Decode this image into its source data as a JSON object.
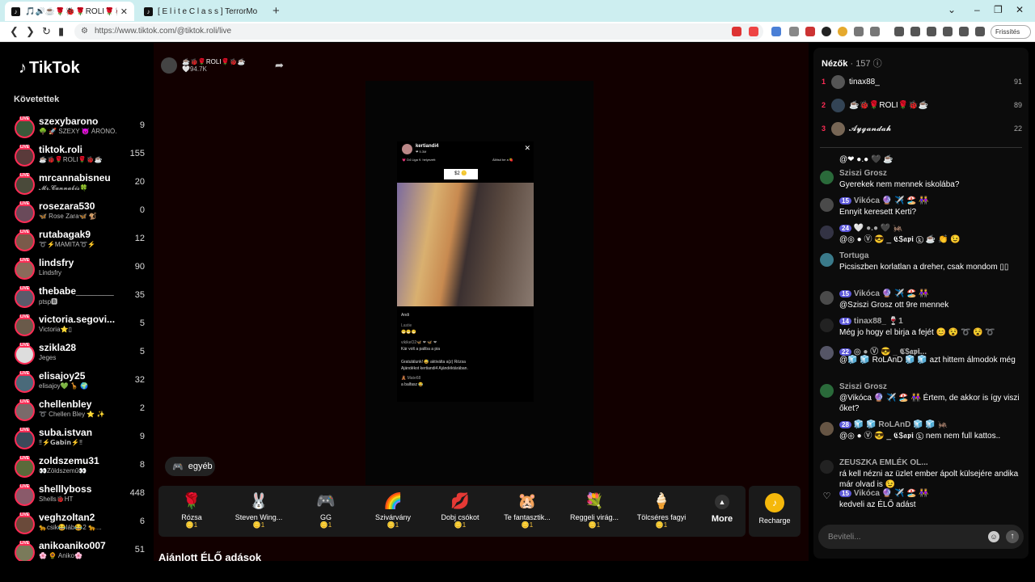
{
  "browser": {
    "tabs": [
      {
        "label": "🎵🔊☕🌹🐞🌹ROLI🌹🐞☕ (@tik",
        "active": true
      },
      {
        "label": "[ E l i t e  C l a s s ] TerrorMo",
        "active": false
      }
    ],
    "url": "https://www.tiktok.com/@tiktok.roli/live",
    "refresh_label": "Frissítés"
  },
  "logo": "TikTok",
  "sidebar": {
    "following_title": "Követettek",
    "items": [
      {
        "name": "szexybarono",
        "sub": "🌳 🚀 SZEXY 👿 ÁRÓNÓ...",
        "count": "9"
      },
      {
        "name": "tiktok.roli",
        "sub": "☕🐞🌹ROLI🌹🐞☕",
        "count": "155"
      },
      {
        "name": "mrcannabisneu",
        "sub": "𝓜𝓻.𝓒𝓪𝓷𝓷𝓪𝓫𝓲𝓼🍀",
        "count": "20"
      },
      {
        "name": "rosezara530",
        "sub": "🦋 Rose Zara🦋 🐒",
        "count": "0"
      },
      {
        "name": "rutabagak9",
        "sub": "➰⚡MAMITA➰⚡",
        "count": "12"
      },
      {
        "name": "lindsfry",
        "sub": "Lindsfry",
        "count": "90"
      },
      {
        "name": "thebabe_______",
        "sub": "ptsp🅱",
        "count": "35"
      },
      {
        "name": "victoria.segovi...",
        "sub": "Victoria⭐▯",
        "count": "5"
      },
      {
        "name": "szikla28",
        "sub": "Jeges",
        "count": "5"
      },
      {
        "name": "elisajoy25",
        "sub": "elisajoy💚 🦒 🌍",
        "count": "32"
      },
      {
        "name": "chellenbley",
        "sub": "➰ Chellen Bley ⭐ ✨",
        "count": "2"
      },
      {
        "name": "suba.istvan",
        "sub": "‼⚡𝗚𝗮𝗯𝗶𝗻⚡‼",
        "count": "9"
      },
      {
        "name": "zoldszemu31",
        "sub": "👀Zöldszemű👀",
        "count": "8"
      },
      {
        "name": "shelllyboss",
        "sub": "Shells🐞HT",
        "count": "448"
      },
      {
        "name": "veghzoltan2",
        "sub": "🐆csik😂láb😂2 🐆...",
        "count": "6"
      },
      {
        "name": "anikoaniko007",
        "sub": "🌸 🌻 Aniko🌸",
        "count": "51"
      }
    ]
  },
  "stream": {
    "streamer_name": "☕🐞🌹ROLI🌹🐞☕",
    "likes": "🤍94.7K",
    "inner": {
      "host": "kertiandi4",
      "host_likes": "❤ 5.3M",
      "league": "💗 D4 Liga 9. helyezett",
      "goal": "Állítsd be a 🍓",
      "score": "$2 🪙",
      "chat": [
        "Andi",
        "Lastie",
        "😁😁😁",
        "vikikeO2🦋 ❤ 🦋 ❤",
        "Kár volt a paliba a pia",
        "Gratulálunk! 😅 aktiválta a(z) Rózsa",
        "Ajándékot kertiandi4 Ajándéktárában.",
        "🧸 Mate68",
        "a balfasz 😂"
      ]
    },
    "gift_button": "egyéb",
    "gifts": [
      {
        "icon": "🌹",
        "name": "Rózsa",
        "price": "🪙1"
      },
      {
        "icon": "🐰",
        "name": "Steven Wing...",
        "price": "🪙1"
      },
      {
        "icon": "🎮",
        "name": "GG",
        "price": "🪙1"
      },
      {
        "icon": "🌈",
        "name": "Szivárvány",
        "price": "🪙1"
      },
      {
        "icon": "💋",
        "name": "Dobj csókot",
        "price": "🪙1"
      },
      {
        "icon": "🐹",
        "name": "Te fantasztik...",
        "price": "🪙1"
      },
      {
        "icon": "💐",
        "name": "Reggeli virág...",
        "price": "🪙1"
      },
      {
        "icon": "🍦",
        "name": "Tölcséres fagyi",
        "price": "🪙1"
      }
    ],
    "more_label": "More",
    "recharge_label": "Recharge",
    "recommended": "Ajánlott ÉLŐ adások"
  },
  "chat": {
    "viewers_label": "Nézők",
    "viewer_count": "· 157",
    "top": [
      {
        "rank": "1",
        "name": "tinax88_",
        "score": "91"
      },
      {
        "rank": "2",
        "name": "☕🐞🌹ROLI🌹🐞☕",
        "score": "89"
      },
      {
        "rank": "3",
        "name": "𝓐𝔂𝓰𝓪𝓷𝓭𝓪𝓱",
        "score": "22"
      }
    ],
    "messages": [
      {
        "badge": "",
        "author": "",
        "text": "@❤ ●.● 🖤 ☕"
      },
      {
        "badge": "",
        "author": "Szi­szi Grosz",
        "text": "Gyerekek nem mennek iskolába?"
      },
      {
        "badge": "15",
        "author": "Vikóca 🔮 ✈️ 🏖️ 👭",
        "text": "Ennyit keresett Kerti?"
      },
      {
        "badge": "24",
        "author": "🤍 ●.● 🖤 🦗",
        "text": "@◎ ● Ⓥ 😎 _ 𝕮$𝖆𝖕𝖎 ⓚ ☕ 👏 😉"
      },
      {
        "badge": "",
        "author": "Tortuga",
        "text": "Picsiszben korlatlan a dreher, csak mondom ▯▯"
      },
      {
        "badge": "15",
        "author": "Vikóca 🔮 ✈️ 🏖️ 👭",
        "text": "@Sziszi Grosz ott 9re mennek"
      },
      {
        "badge": "14",
        "author": "tinax88_ 🍷1",
        "text": "Még jo hogy el birja a fejét 😊 😵 ➰ 😵 ➰"
      },
      {
        "badge": "22",
        "author": "◎ ● Ⓥ 😎 _ 𝕮$𝖆𝖕𝖎...",
        "text": "@🧊 🧊 RoLAnD 🧊 🧊 azt hittem álmodok még"
      },
      {
        "badge": "",
        "author": "Sziszi Grosz",
        "text": "@Vikóca 🔮 ✈️ 🏖️ 👭 Értem, de akkor is így viszi őket?"
      },
      {
        "badge": "28",
        "author": "🧊 🧊 RoLAnD 🧊 🧊 🦗",
        "text": "@◎ ● Ⓥ 😎 _ 𝕮$𝖆𝖕𝖎 ⓚ nem nem full kattos.."
      },
      {
        "badge": "",
        "author": "ZEUSZKA EMLÉK OL...",
        "text": "rá kell nézni az üzlet ember ápolt külsejére andika már olvad is 😉"
      },
      {
        "badge": "15",
        "author": "Vikóca 🔮 ✈️ 🏖️ 👭",
        "text": "kedveli az ÉLŐ adást"
      }
    ],
    "input_placeholder": "Beviteli..."
  }
}
